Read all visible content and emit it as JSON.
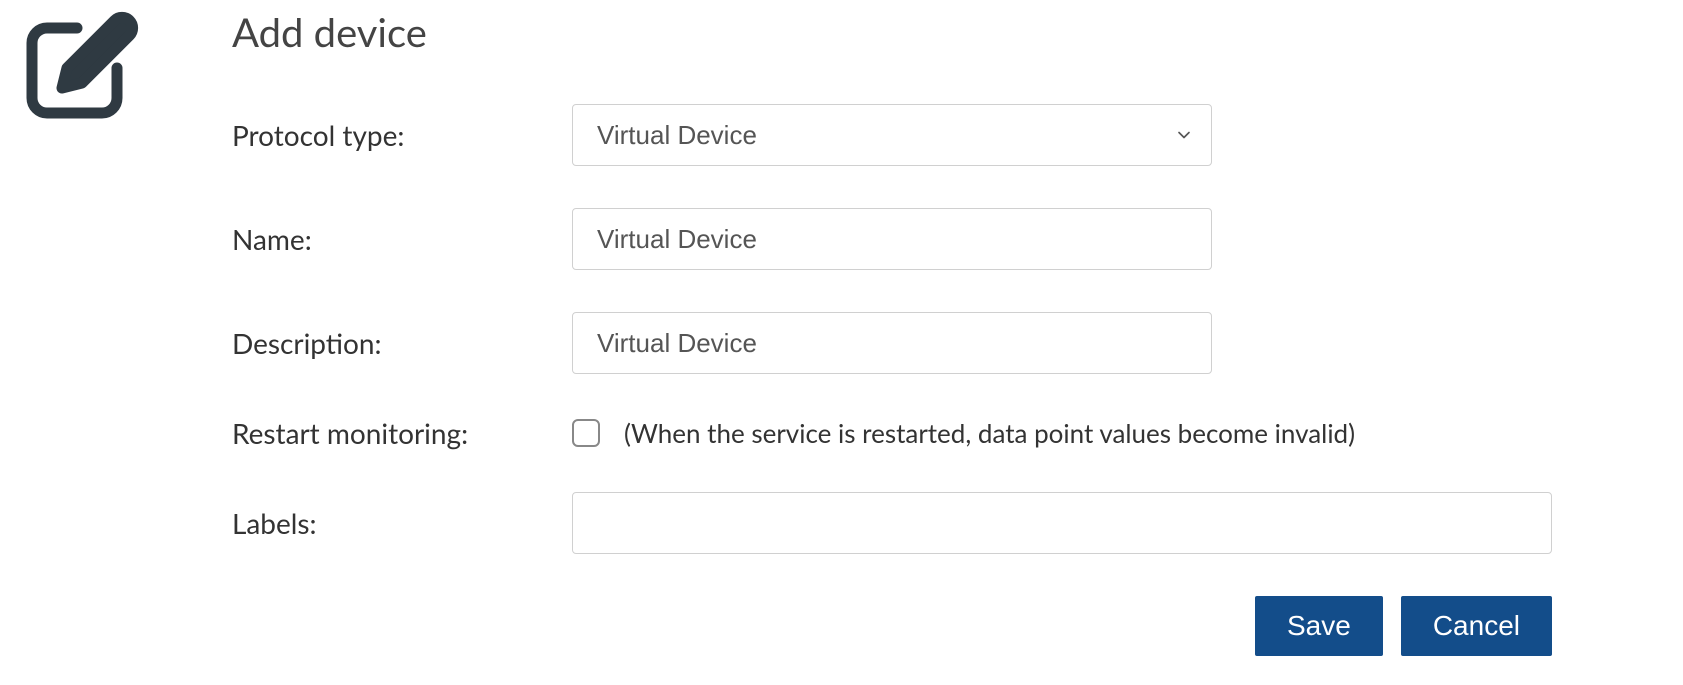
{
  "page": {
    "title": "Add device"
  },
  "form": {
    "protocol_type": {
      "label": "Protocol type:",
      "selected": "Virtual Device"
    },
    "name": {
      "label": "Name:",
      "value": "Virtual Device"
    },
    "description": {
      "label": "Description:",
      "value": "Virtual Device"
    },
    "restart_monitoring": {
      "label": "Restart monitoring:",
      "checked": false,
      "help": "(When the service is restarted, data point values become invalid)"
    },
    "labels": {
      "label": "Labels:",
      "value": ""
    }
  },
  "buttons": {
    "save": "Save",
    "cancel": "Cancel"
  }
}
